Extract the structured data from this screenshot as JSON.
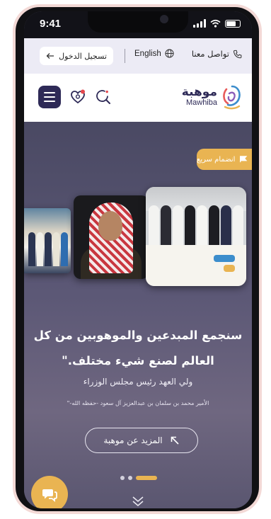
{
  "status_bar": {
    "time": "9:41"
  },
  "top_bar": {
    "login_label": "تسجيل الدخول",
    "language_label": "English",
    "contact_label": "تواصل معنا"
  },
  "nav": {
    "logo_ar": "موهبة",
    "logo_en": "Mawhiba",
    "brand_color": "#2e2a57"
  },
  "hero": {
    "quick_tag": "انضمام سريع",
    "quote": "سنجمع المبدعين والموهوبين من كل العالم لصنع شيء مختلف.\"",
    "title_line": "ولي العهد رئيس مجلس الوزراء",
    "name_line": "الأمير محمد بن سلمان بن عبدالعزيز آل سعود -حفظه الله-\"",
    "more_button": "المزيد عن موهبة",
    "carousel_active_index": 2,
    "carousel_count": 3,
    "accent_color": "#e9b452"
  },
  "icons": [
    "login-arrow-icon",
    "globe-icon",
    "phone-icon",
    "heart-icon",
    "search-icon",
    "flag-icon",
    "arrow-up-left-icon",
    "chevron-down-icon",
    "chat-icon"
  ]
}
